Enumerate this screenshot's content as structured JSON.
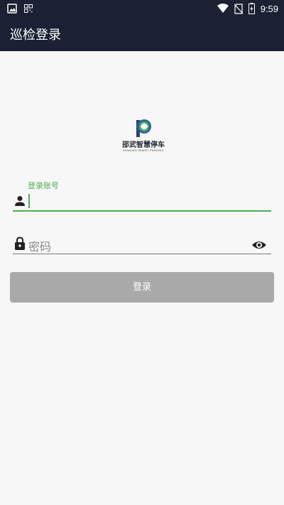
{
  "status_bar": {
    "time": "9:59"
  },
  "app_bar": {
    "title": "巡检登录"
  },
  "logo": {
    "name": "邵武智慧停车",
    "tagline": "SHAOWU SMART PARKING"
  },
  "form": {
    "account_label": "登录账号",
    "account_value": "",
    "password_placeholder": "密码"
  },
  "login_button": {
    "label": "登录"
  },
  "colors": {
    "appbar": "#1b2133",
    "accent": "#4caf50",
    "button": "#a9a9a9",
    "background": "#f7f7f7"
  }
}
